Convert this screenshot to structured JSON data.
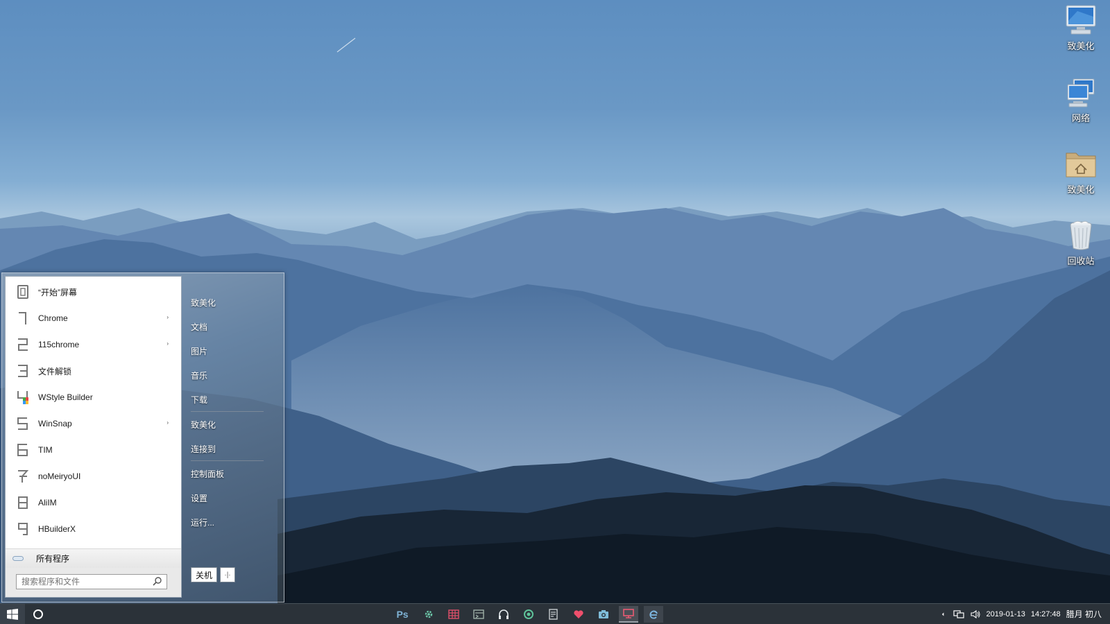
{
  "desktop": {
    "icons": [
      {
        "label": "致美化",
        "icon": "computer-icon"
      },
      {
        "label": "网络",
        "icon": "network-icon"
      },
      {
        "label": "致美化",
        "icon": "home-folder-icon"
      },
      {
        "label": "回收站",
        "icon": "recycle-bin-icon"
      }
    ]
  },
  "start_menu": {
    "programs": [
      {
        "name": "“开始”屏幕",
        "num": "0",
        "has_submenu": false
      },
      {
        "name": "Chrome",
        "num": "1",
        "has_submenu": true
      },
      {
        "name": "115chrome",
        "num": "2",
        "has_submenu": true
      },
      {
        "name": "文件解锁",
        "num": "3",
        "has_submenu": false
      },
      {
        "name": "WStyle Builder",
        "num": "4",
        "has_submenu": false
      },
      {
        "name": "WinSnap",
        "num": "5",
        "has_submenu": true
      },
      {
        "name": "TIM",
        "num": "6",
        "has_submenu": false
      },
      {
        "name": "noMeiryoUI",
        "num": "7",
        "has_submenu": false
      },
      {
        "name": "AliIM",
        "num": "8",
        "has_submenu": false
      },
      {
        "name": "HBuilderX",
        "num": "9",
        "has_submenu": false
      }
    ],
    "submenu_arrow": "›",
    "all_programs_label": "所有程序",
    "search_placeholder": "搜索程序和文件",
    "places": [
      "致美化",
      "文档",
      "图片",
      "音乐",
      "下载",
      "致美化",
      "连接到",
      "控制面板",
      "设置",
      "运行..."
    ],
    "shutdown_label": "关机",
    "shutdown_more_glyph": "·|·"
  },
  "taskbar": {
    "pinned": [
      "photoshop-icon",
      "gear-icon",
      "grid-app-icon",
      "terminal-icon",
      "headphones-icon",
      "refresh-icon",
      "notes-icon",
      "heart-icon",
      "camera-icon",
      "monitor-icon",
      "edge-icon"
    ],
    "ps_label": "Ps",
    "tray": {
      "date": "2019-01-13",
      "time": "14:27:48",
      "lunar": "腊月 初八"
    }
  }
}
